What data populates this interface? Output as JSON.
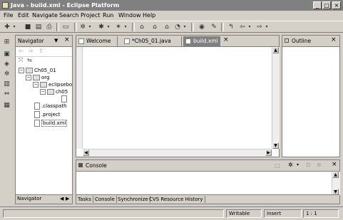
{
  "window": {
    "title": "Java - build.xml - Eclipse Platform",
    "min": "_",
    "max": "□",
    "close": "×"
  },
  "menu": [
    "File",
    "Edit",
    "Navigate",
    "Search",
    "Project",
    "Run",
    "Window",
    "Help"
  ],
  "navigator": {
    "title": "Navigator",
    "menu_glyph": "▼",
    "close": "×",
    "tree": [
      {
        "label": "Ch05_01",
        "kind": "project",
        "expanded": true
      },
      {
        "label": "org",
        "kind": "folder",
        "expanded": true
      },
      {
        "label": "eclipsebo",
        "kind": "folder",
        "expanded": true
      },
      {
        "label": "ch05",
        "kind": "folder",
        "expanded": true
      },
      {
        "label": ".classpath",
        "kind": "file"
      },
      {
        "label": ".project",
        "kind": "file"
      },
      {
        "label": "build.xml",
        "kind": "file",
        "selected": true
      }
    ],
    "bottom_tab": "Navigator"
  },
  "editor": {
    "tabs": [
      {
        "label": "Welcome",
        "active": false
      },
      {
        "label": "*Ch05_01.java",
        "active": false
      },
      {
        "label": "build.xml",
        "active": true
      }
    ],
    "close": "×"
  },
  "outline": {
    "title": "Outline",
    "close": "×"
  },
  "console": {
    "title": "Console",
    "close": "×"
  },
  "bottom_tabs": [
    "Tasks",
    "Console",
    "Synchronize",
    "CVS Resource History"
  ],
  "status": {
    "writable": "Writable",
    "mode": "Insert",
    "position": "1 : 1"
  }
}
